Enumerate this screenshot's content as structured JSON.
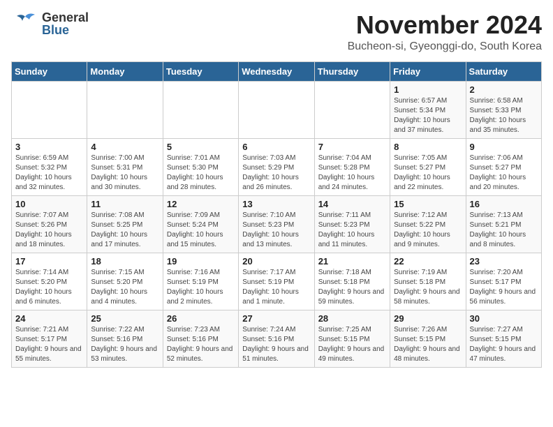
{
  "header": {
    "logo_general": "General",
    "logo_blue": "Blue",
    "month_title": "November 2024",
    "subtitle": "Bucheon-si, Gyeonggi-do, South Korea"
  },
  "days_of_week": [
    "Sunday",
    "Monday",
    "Tuesday",
    "Wednesday",
    "Thursday",
    "Friday",
    "Saturday"
  ],
  "weeks": [
    {
      "days": [
        {
          "number": "",
          "info": ""
        },
        {
          "number": "",
          "info": ""
        },
        {
          "number": "",
          "info": ""
        },
        {
          "number": "",
          "info": ""
        },
        {
          "number": "",
          "info": ""
        },
        {
          "number": "1",
          "info": "Sunrise: 6:57 AM\nSunset: 5:34 PM\nDaylight: 10 hours and 37 minutes."
        },
        {
          "number": "2",
          "info": "Sunrise: 6:58 AM\nSunset: 5:33 PM\nDaylight: 10 hours and 35 minutes."
        }
      ]
    },
    {
      "days": [
        {
          "number": "3",
          "info": "Sunrise: 6:59 AM\nSunset: 5:32 PM\nDaylight: 10 hours and 32 minutes."
        },
        {
          "number": "4",
          "info": "Sunrise: 7:00 AM\nSunset: 5:31 PM\nDaylight: 10 hours and 30 minutes."
        },
        {
          "number": "5",
          "info": "Sunrise: 7:01 AM\nSunset: 5:30 PM\nDaylight: 10 hours and 28 minutes."
        },
        {
          "number": "6",
          "info": "Sunrise: 7:03 AM\nSunset: 5:29 PM\nDaylight: 10 hours and 26 minutes."
        },
        {
          "number": "7",
          "info": "Sunrise: 7:04 AM\nSunset: 5:28 PM\nDaylight: 10 hours and 24 minutes."
        },
        {
          "number": "8",
          "info": "Sunrise: 7:05 AM\nSunset: 5:27 PM\nDaylight: 10 hours and 22 minutes."
        },
        {
          "number": "9",
          "info": "Sunrise: 7:06 AM\nSunset: 5:27 PM\nDaylight: 10 hours and 20 minutes."
        }
      ]
    },
    {
      "days": [
        {
          "number": "10",
          "info": "Sunrise: 7:07 AM\nSunset: 5:26 PM\nDaylight: 10 hours and 18 minutes."
        },
        {
          "number": "11",
          "info": "Sunrise: 7:08 AM\nSunset: 5:25 PM\nDaylight: 10 hours and 17 minutes."
        },
        {
          "number": "12",
          "info": "Sunrise: 7:09 AM\nSunset: 5:24 PM\nDaylight: 10 hours and 15 minutes."
        },
        {
          "number": "13",
          "info": "Sunrise: 7:10 AM\nSunset: 5:23 PM\nDaylight: 10 hours and 13 minutes."
        },
        {
          "number": "14",
          "info": "Sunrise: 7:11 AM\nSunset: 5:23 PM\nDaylight: 10 hours and 11 minutes."
        },
        {
          "number": "15",
          "info": "Sunrise: 7:12 AM\nSunset: 5:22 PM\nDaylight: 10 hours and 9 minutes."
        },
        {
          "number": "16",
          "info": "Sunrise: 7:13 AM\nSunset: 5:21 PM\nDaylight: 10 hours and 8 minutes."
        }
      ]
    },
    {
      "days": [
        {
          "number": "17",
          "info": "Sunrise: 7:14 AM\nSunset: 5:20 PM\nDaylight: 10 hours and 6 minutes."
        },
        {
          "number": "18",
          "info": "Sunrise: 7:15 AM\nSunset: 5:20 PM\nDaylight: 10 hours and 4 minutes."
        },
        {
          "number": "19",
          "info": "Sunrise: 7:16 AM\nSunset: 5:19 PM\nDaylight: 10 hours and 2 minutes."
        },
        {
          "number": "20",
          "info": "Sunrise: 7:17 AM\nSunset: 5:19 PM\nDaylight: 10 hours and 1 minute."
        },
        {
          "number": "21",
          "info": "Sunrise: 7:18 AM\nSunset: 5:18 PM\nDaylight: 9 hours and 59 minutes."
        },
        {
          "number": "22",
          "info": "Sunrise: 7:19 AM\nSunset: 5:18 PM\nDaylight: 9 hours and 58 minutes."
        },
        {
          "number": "23",
          "info": "Sunrise: 7:20 AM\nSunset: 5:17 PM\nDaylight: 9 hours and 56 minutes."
        }
      ]
    },
    {
      "days": [
        {
          "number": "24",
          "info": "Sunrise: 7:21 AM\nSunset: 5:17 PM\nDaylight: 9 hours and 55 minutes."
        },
        {
          "number": "25",
          "info": "Sunrise: 7:22 AM\nSunset: 5:16 PM\nDaylight: 9 hours and 53 minutes."
        },
        {
          "number": "26",
          "info": "Sunrise: 7:23 AM\nSunset: 5:16 PM\nDaylight: 9 hours and 52 minutes."
        },
        {
          "number": "27",
          "info": "Sunrise: 7:24 AM\nSunset: 5:16 PM\nDaylight: 9 hours and 51 minutes."
        },
        {
          "number": "28",
          "info": "Sunrise: 7:25 AM\nSunset: 5:15 PM\nDaylight: 9 hours and 49 minutes."
        },
        {
          "number": "29",
          "info": "Sunrise: 7:26 AM\nSunset: 5:15 PM\nDaylight: 9 hours and 48 minutes."
        },
        {
          "number": "30",
          "info": "Sunrise: 7:27 AM\nSunset: 5:15 PM\nDaylight: 9 hours and 47 minutes."
        }
      ]
    }
  ]
}
